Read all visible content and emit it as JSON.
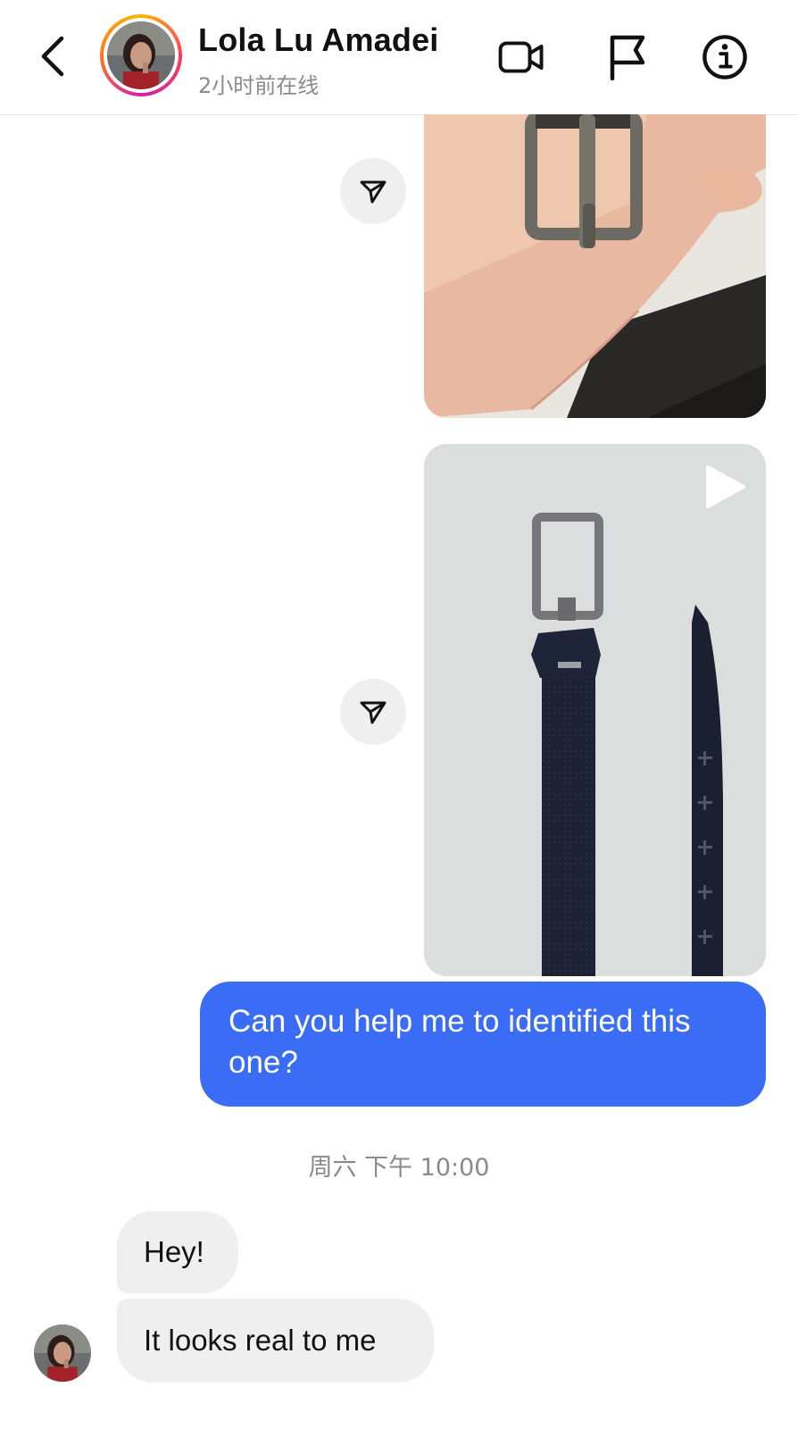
{
  "header": {
    "back_icon": "chevron-left-icon",
    "contact_name": "Lola Lu Amadei",
    "status": "2小时前在线",
    "actions": [
      "video-call-icon",
      "flag-icon",
      "info-icon"
    ]
  },
  "messages": {
    "outgoing_text": "Can you help me to identified this one?",
    "timestamp": "周六 下午 10:00",
    "incoming": [
      {
        "text": "Hey!"
      },
      {
        "text": "It looks real to me"
      }
    ]
  },
  "colors": {
    "outgoing_bubble": "#3b6cf5",
    "incoming_bubble": "#efefef",
    "story_ring": [
      "#ffb400",
      "#ff3d5a",
      "#d21ea8"
    ]
  }
}
